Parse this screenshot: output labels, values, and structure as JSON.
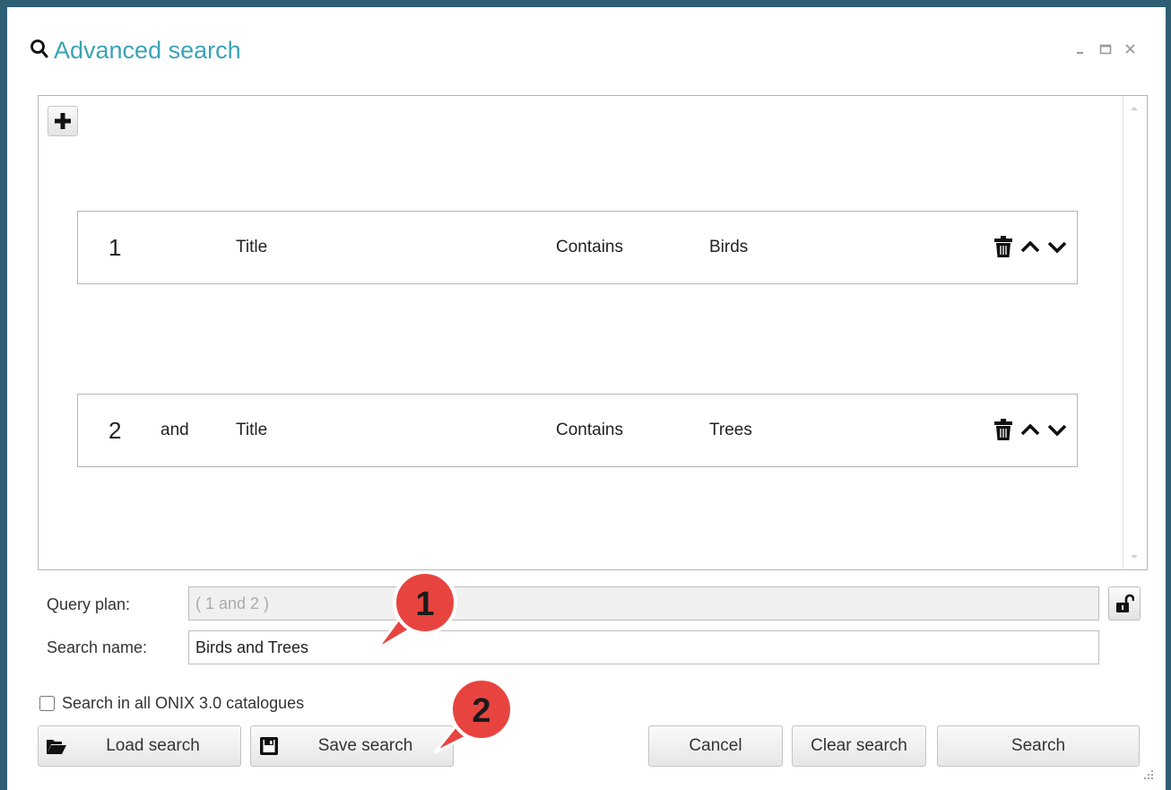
{
  "window": {
    "title": "Advanced search",
    "icons": {
      "title": "search-icon",
      "minimize": "minimize-icon",
      "maximize": "maximize-icon",
      "close": "close-icon"
    }
  },
  "criteria": {
    "add_icon": "plus-icon",
    "rows": [
      {
        "number": "1",
        "operator": "",
        "field": "Title",
        "condition": "Contains",
        "value": "Birds"
      },
      {
        "number": "2",
        "operator": "and",
        "field": "Title",
        "condition": "Contains",
        "value": "Trees"
      }
    ],
    "row_icons": {
      "delete": "trash-icon",
      "move_up": "chevron-up-icon",
      "move_down": "chevron-down-icon"
    }
  },
  "query_plan": {
    "label": "Query plan:",
    "value": "( 1 and 2 )",
    "lock_icon": "unlock-icon"
  },
  "search_name": {
    "label": "Search name:",
    "value": "Birds and Trees"
  },
  "all_catalogues": {
    "label": "Search in all ONIX 3.0 catalogues",
    "checked": false
  },
  "buttons": {
    "load": "Load search",
    "save": "Save search",
    "cancel": "Cancel",
    "clear": "Clear search",
    "search": "Search"
  },
  "callouts": [
    {
      "number": "1",
      "color": "#e8443f"
    },
    {
      "number": "2",
      "color": "#e8443f"
    }
  ],
  "colors": {
    "title": "#3aa3b4",
    "frame": "#2e5f73",
    "callout": "#e8443f"
  }
}
